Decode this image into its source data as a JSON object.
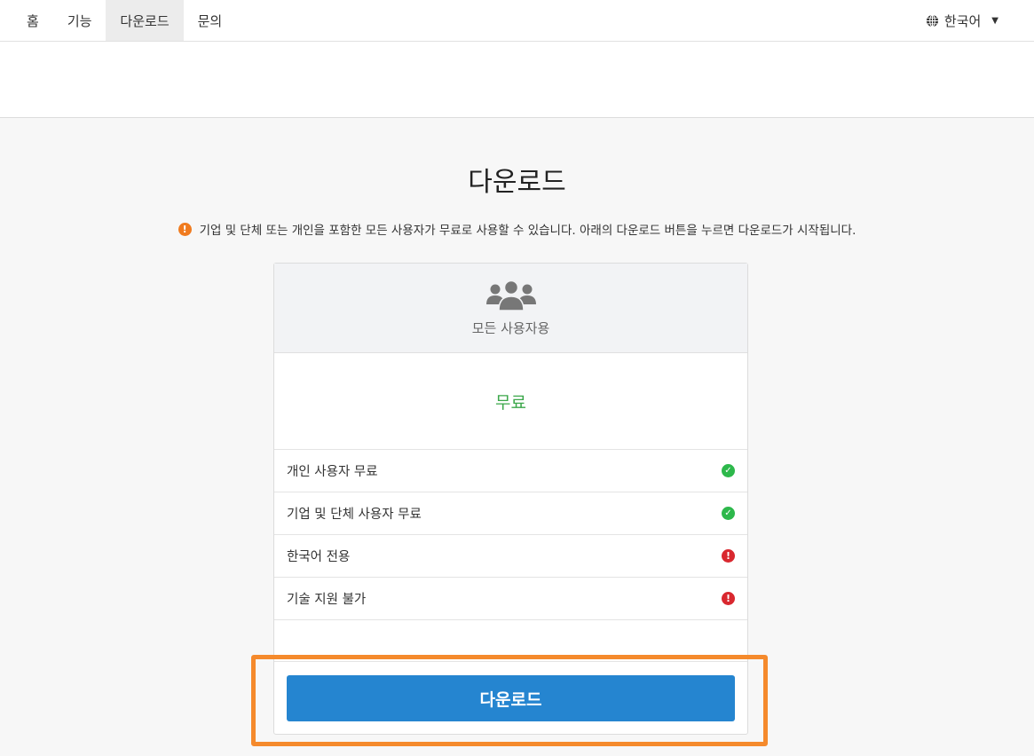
{
  "nav": {
    "items": [
      {
        "label": "홈"
      },
      {
        "label": "기능"
      },
      {
        "label": "다운로드",
        "active": true
      },
      {
        "label": "문의"
      }
    ],
    "language": "한국어"
  },
  "main": {
    "title": "다운로드",
    "notice": "기업 및 단체 또는 개인을 포함한 모든 사용자가 무료로 사용할 수 있습니다. 아래의 다운로드 버튼을 누르면 다운로드가 시작됩니다."
  },
  "card": {
    "icon": "users-icon",
    "plan_name": "모든 사용자용",
    "price": "무료",
    "features": [
      {
        "label": "개인 사용자 무료",
        "status": "ok"
      },
      {
        "label": "기업 및 단체 사용자 무료",
        "status": "ok"
      },
      {
        "label": "한국어 전용",
        "status": "no"
      },
      {
        "label": "기술 지원 불가",
        "status": "no"
      }
    ],
    "download_label": "다운로드"
  },
  "colors": {
    "accent": "#2585d0",
    "success": "#2db84b",
    "danger": "#d9282f",
    "warning": "#f07b1f",
    "highlight": "#f58a2c",
    "price": "#3ba74a"
  }
}
